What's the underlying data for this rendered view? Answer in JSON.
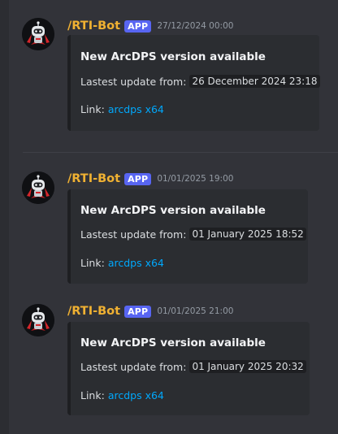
{
  "messages": [
    {
      "username": "/RTI-Bot",
      "badge": "APP",
      "timestamp": "27/12/2024 00:00",
      "embed": {
        "title": "New ArcDPS version available",
        "update_label": "Lastest update from:",
        "update_value": "26 December 2024 23:18",
        "link_label": "Link:",
        "link_text": "arcdps x64"
      }
    },
    {
      "username": "/RTI-Bot",
      "badge": "APP",
      "timestamp": "01/01/2025 19:00",
      "embed": {
        "title": "New ArcDPS version available",
        "update_label": "Lastest update from:",
        "update_value": "01 January 2025 18:52",
        "link_label": "Link:",
        "link_text": "arcdps x64"
      }
    },
    {
      "username": "/RTI-Bot",
      "badge": "APP",
      "timestamp": "01/01/2025 21:00",
      "embed": {
        "title": "New ArcDPS version available",
        "update_label": "Lastest update from:",
        "update_value": "01 January 2025 20:32",
        "link_label": "Link:",
        "link_text": "arcdps x64"
      }
    }
  ],
  "colors": {
    "background": "#323339",
    "username": "#f0b132",
    "badge": "#5865f2",
    "link": "#00a8fc",
    "embed_bg": "#2b2d31"
  },
  "icons": {
    "avatar": "robot-avatar-icon"
  }
}
